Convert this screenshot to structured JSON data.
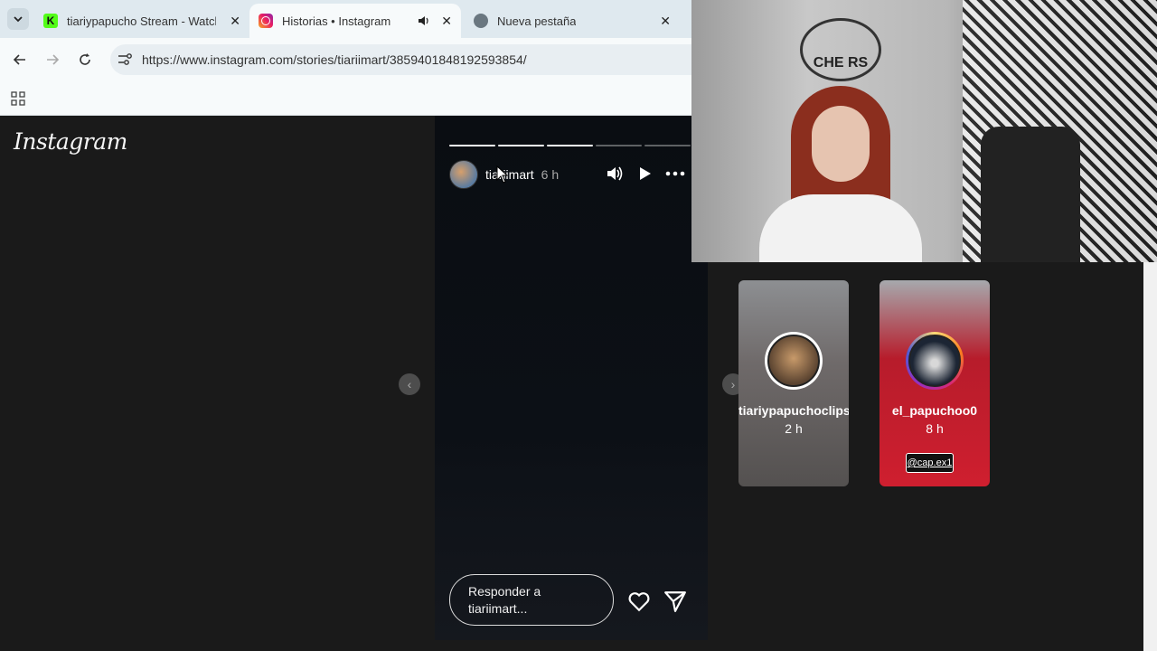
{
  "browser": {
    "tabs": [
      {
        "title": "tiariypapucho Stream - Watch L",
        "icon": "kick-icon",
        "active": false
      },
      {
        "title": "Historias • Instagram",
        "icon": "instagram-icon",
        "active": true
      },
      {
        "title": "Nueva pestaña",
        "icon": "globe-icon",
        "active": false
      }
    ],
    "url": "https://www.instagram.com/stories/tiariimart/3859401848192593854/"
  },
  "instagram": {
    "logo": "Instagram",
    "story": {
      "username": "tiariimart",
      "time": "6 h",
      "progress_segments": 5,
      "progress_done": 3,
      "reply_placeholder": "Responder a tiariimart..."
    },
    "next_stories": [
      {
        "username": "tiariypapuchoclips",
        "time": "2 h"
      },
      {
        "username": "el_papuchoo0",
        "time": "8 h",
        "tag": "@cap.ex1"
      }
    ]
  },
  "webcam": {
    "sign_text": "CHE RS"
  }
}
